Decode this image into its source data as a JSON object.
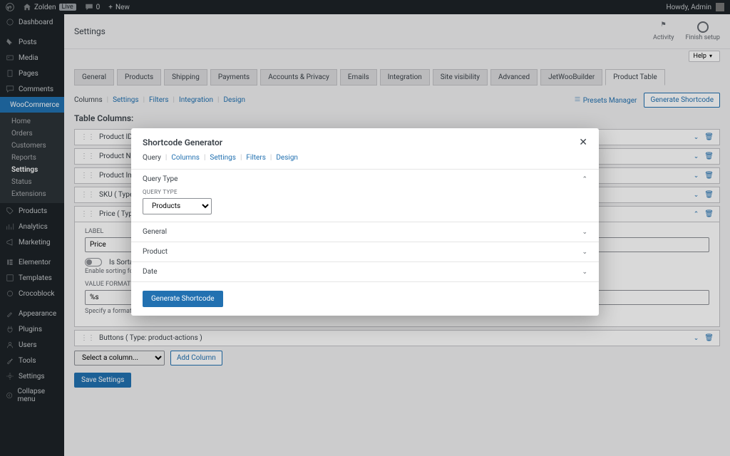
{
  "adminbar": {
    "site_name": "Zolden",
    "live": "Live",
    "comments_count": "0",
    "new": "New",
    "howdy": "Howdy, Admin"
  },
  "sidemenu": {
    "dashboard": "Dashboard",
    "posts": "Posts",
    "media": "Media",
    "pages": "Pages",
    "comments": "Comments",
    "woocommerce": "WooCommerce",
    "sub": {
      "home": "Home",
      "orders": "Orders",
      "customers": "Customers",
      "reports": "Reports",
      "settings": "Settings",
      "status": "Status",
      "extensions": "Extensions"
    },
    "products": "Products",
    "analytics": "Analytics",
    "marketing": "Marketing",
    "elementor": "Elementor",
    "templates": "Templates",
    "crocoblock": "Crocoblock",
    "appearance": "Appearance",
    "plugins": "Plugins",
    "users": "Users",
    "tools": "Tools",
    "settings2": "Settings",
    "collapse": "Collapse menu"
  },
  "page": {
    "title": "Settings",
    "activity": "Activity",
    "finish_setup": "Finish setup",
    "help": "Help"
  },
  "tabs": [
    "General",
    "Products",
    "Shipping",
    "Payments",
    "Accounts & Privacy",
    "Emails",
    "Integration",
    "Site visibility",
    "Advanced",
    "JetWooBuilder",
    "Product Table"
  ],
  "subtabs": [
    "Columns",
    "Settings",
    "Filters",
    "Integration",
    "Design"
  ],
  "subhead": {
    "presets": "Presets Manager",
    "generate": "Generate Shortcode"
  },
  "table": {
    "heading": "Table Columns:",
    "cols": [
      "Product ID ( Type: product-id )",
      "Product Name ( Type: product-name )",
      "Product Image ( Type: product-image )",
      "SKU ( Type: product-sku )",
      "Price ( Type: product-price )",
      "Buttons ( Type: product-actions )"
    ],
    "expanded": {
      "label_caption": "LABEL",
      "label_value": "Price",
      "sortable_label": "Is Sortable",
      "sortable_help": "Enable sorting for this column",
      "vf_caption": "VALUE FORMAT",
      "vf_value": "%s",
      "vf_help": "Specify a format for the ..."
    },
    "select_placeholder": "Select a column...",
    "add_column": "Add Column",
    "save": "Save Settings"
  },
  "modal": {
    "title": "Shortcode Generator",
    "tabs": [
      "Query",
      "Columns",
      "Settings",
      "Filters",
      "Design"
    ],
    "query_type_heading": "Query Type",
    "query_type_label": "QUERY TYPE",
    "query_type_value": "Products",
    "sections": [
      "General",
      "Product",
      "Date"
    ],
    "generate": "Generate Shortcode"
  }
}
